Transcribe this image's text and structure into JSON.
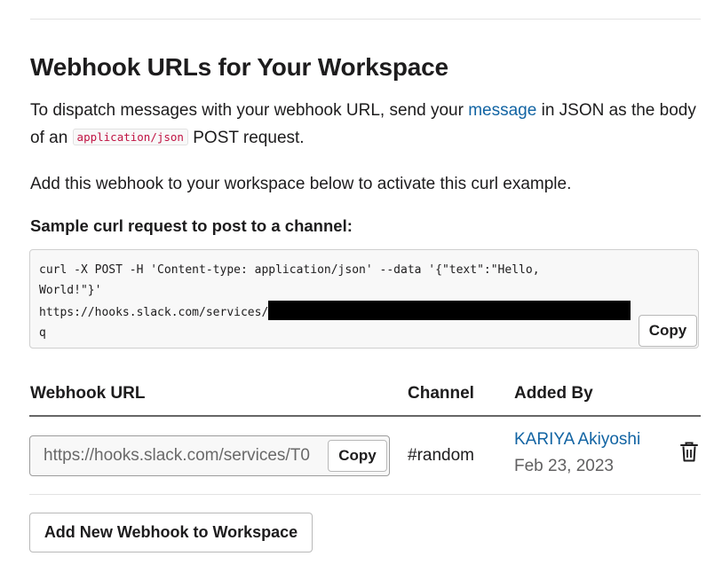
{
  "heading": "Webhook URLs for Your Workspace",
  "intro": {
    "before": "To dispatch messages with your webhook URL, send your ",
    "link": "message",
    "middle": " in JSON as the body of an ",
    "code": "application/json",
    "after": " POST request."
  },
  "activate_note": "Add this webhook to your workspace below to activate this curl example.",
  "sample": {
    "heading": "Sample curl request to post to a channel:",
    "line1": "curl -X POST -H 'Content-type: application/json' --data '{\"text\":\"Hello,",
    "line2": "World!\"}'",
    "line3": "https://hooks.slack.com/services/",
    "line4": "q",
    "copy_label": "Copy"
  },
  "table": {
    "headers": [
      "Webhook URL",
      "Channel",
      "Added By"
    ],
    "rows": [
      {
        "url": "https://hooks.slack.com/services/T0",
        "copy_label": "Copy",
        "channel": "#random",
        "added_by": "KARIYA Akiyoshi",
        "date": "Feb 23, 2023",
        "delete_icon": "trash-icon"
      }
    ]
  },
  "add_button": "Add New Webhook to Workspace",
  "colors": {
    "link": "#1264a3",
    "code_text": "#c01343",
    "code_bg": "#f8f8f8"
  }
}
